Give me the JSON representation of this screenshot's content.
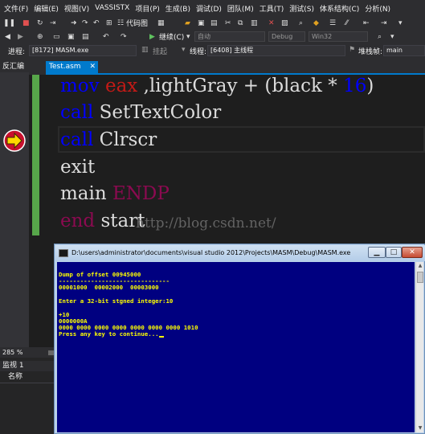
{
  "menu": [
    "文件(F)",
    "编辑(E)",
    "视图(V)",
    "VASSISTX",
    "项目(P)",
    "生成(B)",
    "调试(D)",
    "团队(M)",
    "工具(T)",
    "测试(S)",
    "体系结构(C)",
    "分析(N)"
  ],
  "toolbar1": {
    "code_map_label": "代码图",
    "continue_label": "继续(C)",
    "config_combo": "自动",
    "build_config": "Debug",
    "platform": "Win32"
  },
  "procbar": {
    "process_label": "进程:",
    "process_value": "[8172] MASM.exe",
    "suspend_label": "挂起",
    "thread_label": "线程:",
    "thread_value": "[6408] 主线程",
    "stack_label": "堆栈帧:",
    "stack_value": "main"
  },
  "left_panel": {
    "tab_label": "反汇编"
  },
  "document_tab": {
    "label": "Test.asm",
    "close": "✕"
  },
  "code": {
    "line1": {
      "kw": "mov",
      "reg": "eax",
      "mid": ",lightGray + (black *",
      "num": "16",
      "end": ")"
    },
    "line2": {
      "kw": "call",
      "rest": "SetTextColor"
    },
    "line3": {
      "kw": "call",
      "rest": "Clrscr"
    },
    "line4": {
      "rest": "exit"
    },
    "line5": {
      "rest": "main",
      "kw2": "ENDP"
    },
    "line6": {
      "kw2": "end",
      "rest": "start"
    }
  },
  "watermark": "http://blog.csdn.net/",
  "zoom": "285 %",
  "watch": {
    "title": "监视 1",
    "column": "名称"
  },
  "console": {
    "title": "D:\\users\\administrator\\documents\\visual studio 2012\\Projects\\MASM\\Debug\\MASM.exe",
    "lines": [
      "Dump of offset 00945000",
      "-------------------------------",
      "00001000  00002000  00003000",
      "",
      "Enter a 32-bit stgned integer:10",
      "",
      "+10",
      "0000000A",
      "0000 0000 0000 0000 0000 0000 0000 1010",
      "Press any key to continue..."
    ]
  },
  "colors": {
    "accent": "#007acc",
    "console_bg": "#000080",
    "console_text": "#ffff00",
    "keyword": "#0000ff",
    "keyword2": "#8b0a50",
    "register": "#c41a16",
    "change_marker": "#57a64a"
  }
}
